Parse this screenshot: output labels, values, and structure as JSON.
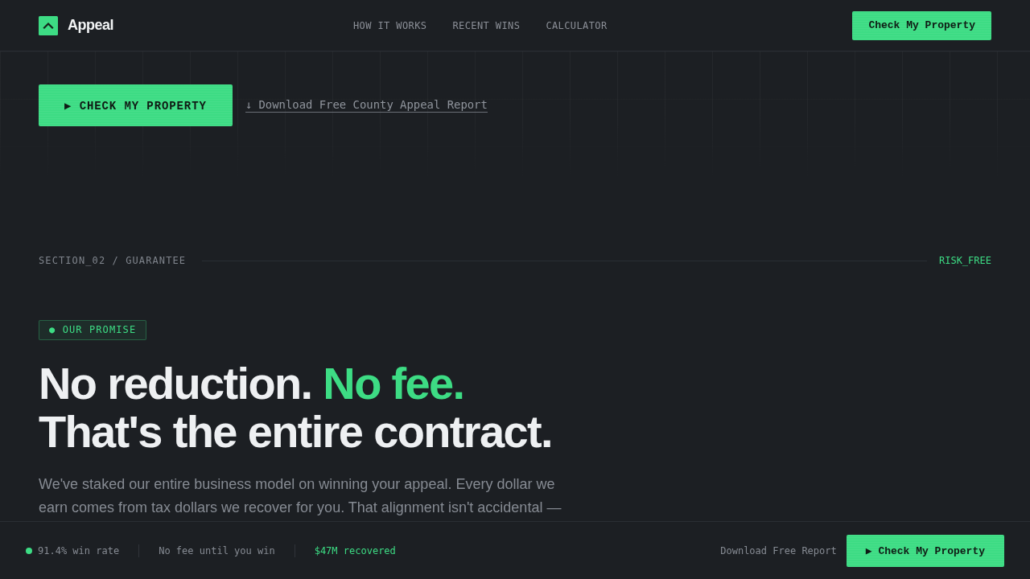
{
  "header": {
    "logo": "Appeal",
    "nav": [
      "HOW IT WORKS",
      "RECENT WINS",
      "CALCULATOR"
    ],
    "cta": "Check My Property"
  },
  "hero": {
    "primary_button": "▶ CHECK MY PROPERTY",
    "report_link": "↓ Download Free County Appeal Report"
  },
  "section": {
    "label": "SECTION_02 / GUARANTEE",
    "tag": "RISK_FREE",
    "badge": "● OUR PROMISE",
    "heading": {
      "lead": "No reduction.",
      "accent": "No fee.",
      "line_2": "That's the entire contract."
    },
    "paragraph": "We've staked our entire business model on winning your appeal. Every dollar we earn comes from tax dollars we recover for you. That alignment isn't accidental —"
  },
  "bottom_bar": {
    "stats": [
      {
        "text": "91.4% win rate",
        "dot": true,
        "highlight": false
      },
      {
        "text": "No fee until you win",
        "dot": false,
        "highlight": false
      },
      {
        "text": "$47M recovered",
        "dot": false,
        "highlight": true
      }
    ],
    "report_link": "Download Free Report",
    "cta": "▶ Check My Property"
  }
}
